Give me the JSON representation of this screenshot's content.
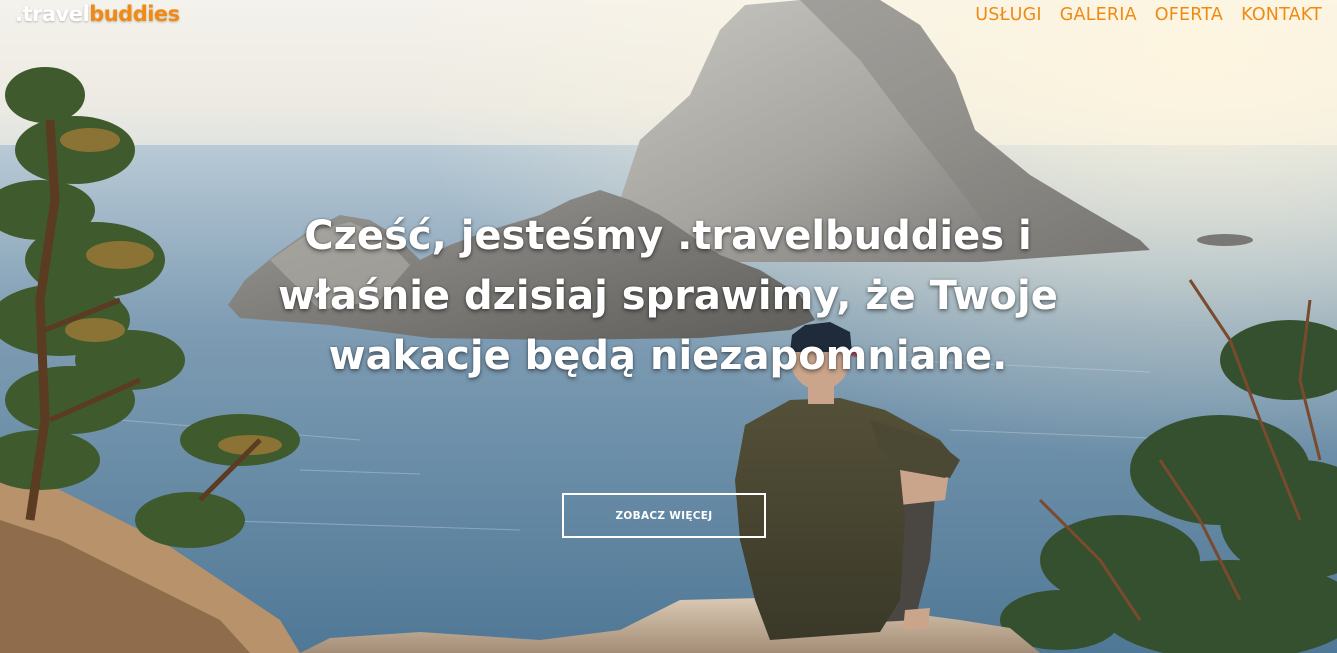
{
  "nav": {
    "logo_prefix": ".travel",
    "logo_suffix": "buddies",
    "menu": [
      {
        "label": "USŁUGI"
      },
      {
        "label": "GALERIA"
      },
      {
        "label": "OFERTA"
      },
      {
        "label": "KONTAKT"
      }
    ]
  },
  "hero": {
    "headline": "Cześć, jesteśmy .travelbuddies i właśnie dzisiaj sprawimy, że Twoje wakacje będą niezapomniane.",
    "cta_label": "ZOBACZ WIĘCEJ"
  },
  "colors": {
    "accent": "#f08a12",
    "text_light": "#ffffff"
  }
}
